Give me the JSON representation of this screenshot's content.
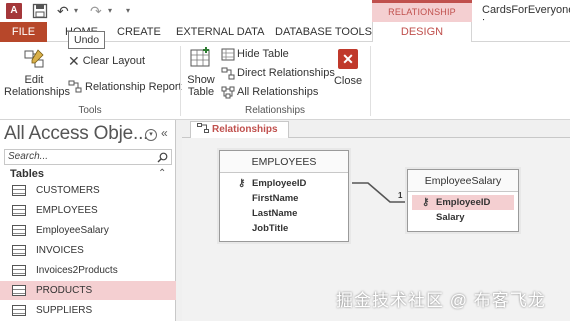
{
  "app": {
    "icon_letter": "A",
    "document_title": "CardsForEveryone :",
    "tools_context": "RELATIONSHIP TOOLS",
    "accent_color": "#c0504d",
    "file_color": "#b7472a"
  },
  "tabs": {
    "file": "FILE",
    "home": "HOME",
    "create": "CREATE",
    "external": "EXTERNAL DATA",
    "dbtools": "DATABASE TOOLS",
    "design": "DESIGN"
  },
  "tooltip": "Undo",
  "ribbon": {
    "tools": {
      "edit_relationships": [
        "Edit",
        "Relationships"
      ],
      "clear_layout": "Clear Layout",
      "relationship_report": "Relationship Report",
      "group_label": "Tools"
    },
    "relationships": {
      "show_table": [
        "Show",
        "Table"
      ],
      "hide_table": "Hide Table",
      "direct_relationships": "Direct Relationships",
      "all_relationships": "All Relationships",
      "close": "Close",
      "group_label": "Relationships"
    }
  },
  "navpane": {
    "title": "All Access Obje...",
    "search_placeholder": "Search...",
    "group": "Tables",
    "items": [
      "CUSTOMERS",
      "EMPLOYEES",
      "EmployeeSalary",
      "INVOICES",
      "Invoices2Products",
      "PRODUCTS",
      "SUPPLIERS"
    ],
    "selected": "PRODUCTS"
  },
  "document": {
    "tab": "Relationships"
  },
  "diagram": {
    "employees": {
      "name": "EMPLOYEES",
      "fields": [
        "EmployeeID",
        "FirstName",
        "LastName",
        "JobTitle"
      ],
      "key": "EmployeeID"
    },
    "salary": {
      "name": "EmployeeSalary",
      "fields": [
        "EmployeeID",
        "Salary"
      ],
      "key": "EmployeeID"
    },
    "cardinality_left": "1",
    "cardinality_right": "1"
  },
  "watermark": "掘金技术社区 @ 布客飞龙"
}
